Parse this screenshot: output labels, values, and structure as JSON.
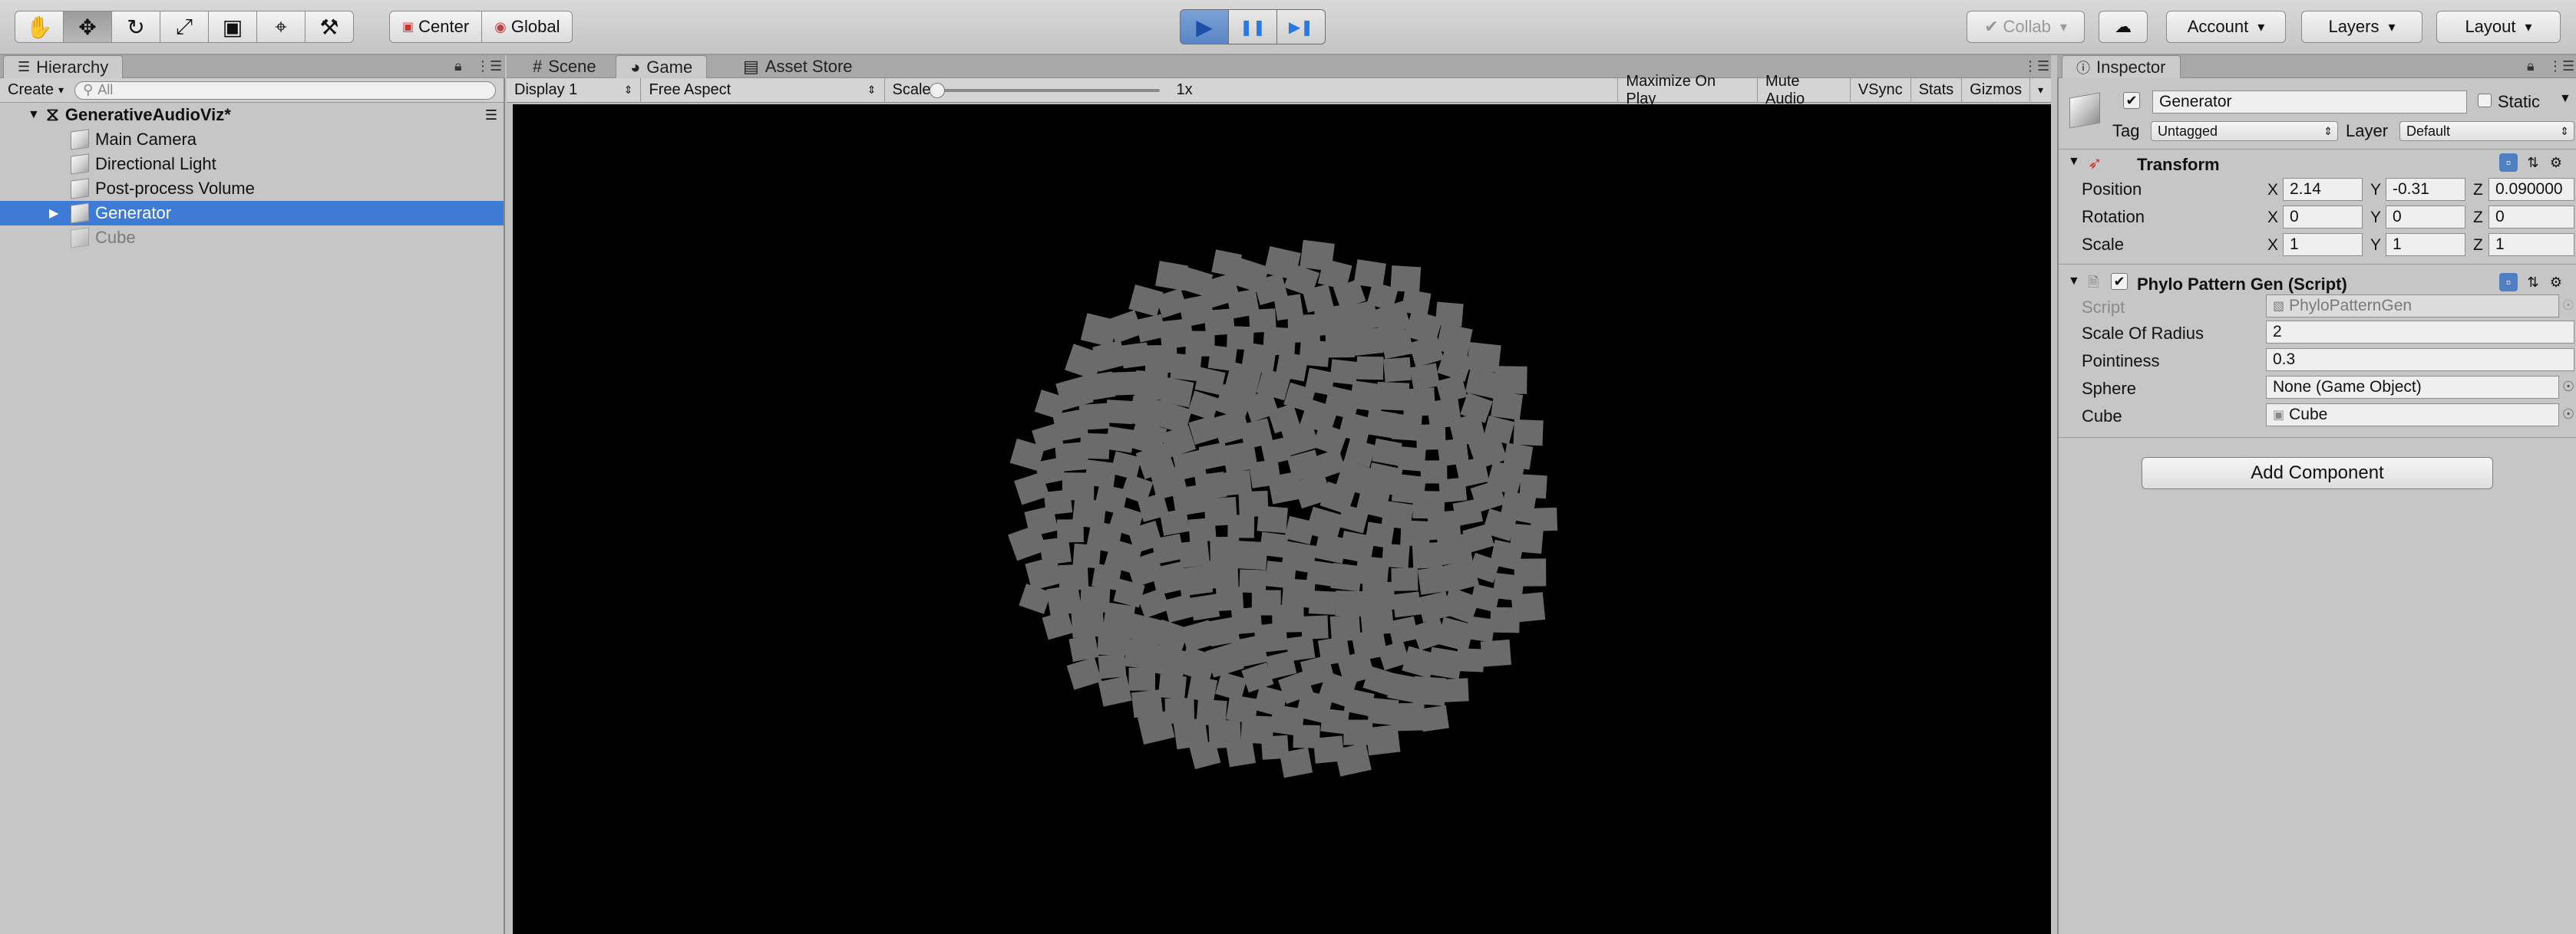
{
  "toolbar": {
    "tools": [
      {
        "name": "hand-tool",
        "icon": "hand-icon",
        "glyph": "✋"
      },
      {
        "name": "move-tool",
        "icon": "move-icon",
        "glyph": "✥"
      },
      {
        "name": "rotate-tool",
        "icon": "rotate-icon",
        "glyph": "↻"
      },
      {
        "name": "scale-tool",
        "icon": "scale-icon",
        "glyph": "⤢"
      },
      {
        "name": "rect-tool",
        "icon": "rect-transform-icon",
        "glyph": "▣"
      },
      {
        "name": "transform-tool",
        "icon": "transform-icon",
        "glyph": "⌖"
      },
      {
        "name": "custom-tool",
        "icon": "wrench-icon",
        "glyph": "⚒"
      }
    ],
    "pivot_label": "Center",
    "space_label": "Global",
    "play_glyph": "▶",
    "pause_glyph": "❚❚",
    "step_glyph": "▶❚",
    "collab_label": "Collab",
    "cloud_glyph": "☁",
    "account_label": "Account",
    "layers_label": "Layers",
    "layout_label": "Layout"
  },
  "hierarchy": {
    "tab_label": "Hierarchy",
    "create_label": "Create",
    "search_placeholder": "All",
    "scene_name": "GenerativeAudioViz*",
    "items": [
      {
        "label": "Main Camera",
        "selected": false,
        "dim": false,
        "expandable": false
      },
      {
        "label": "Directional Light",
        "selected": false,
        "dim": false,
        "expandable": false
      },
      {
        "label": "Post-process Volume",
        "selected": false,
        "dim": false,
        "expandable": false
      },
      {
        "label": "Generator",
        "selected": true,
        "dim": false,
        "expandable": true
      },
      {
        "label": "Cube",
        "selected": false,
        "dim": true,
        "expandable": false
      }
    ]
  },
  "game": {
    "tabs": [
      {
        "label": "Scene",
        "icon": "grid-icon",
        "glyph": "#"
      },
      {
        "label": "Game",
        "icon": "pacman-icon",
        "glyph": "◕"
      },
      {
        "label": "Asset Store",
        "icon": "store-icon",
        "glyph": "▤"
      }
    ],
    "display_label": "Display 1",
    "aspect_label": "Free Aspect",
    "scale_label": "Scale",
    "scale_value": "1x",
    "scale_fraction": 0.0,
    "maximize_label": "Maximize On Play",
    "mute_label": "Mute Audio",
    "vsync_label": "VSync",
    "stats_label": "Stats",
    "gizmos_label": "Gizmos",
    "cube_color": "#6b6b6b",
    "background_color": "#000000"
  },
  "inspector": {
    "tab_label": "Inspector",
    "object_name": "Generator",
    "static_label": "Static",
    "tag_label": "Tag",
    "tag_value": "Untagged",
    "layer_label": "Layer",
    "layer_value": "Default",
    "transform": {
      "title": "Transform",
      "position_label": "Position",
      "rotation_label": "Rotation",
      "scale_label": "Scale",
      "x": "X",
      "y": "Y",
      "z": "Z",
      "position": [
        "2.14",
        "-0.31",
        "0.090000"
      ],
      "rotation": [
        "0",
        "0",
        "0"
      ],
      "scale": [
        "1",
        "1",
        "1"
      ]
    },
    "script_component": {
      "title": "Phylo Pattern Gen (Script)",
      "script_label": "Script",
      "script_value": "PhyloPatternGen",
      "radius_label": "Scale Of Radius",
      "radius_value": "2",
      "pointiness_label": "Pointiness",
      "pointiness_value": "0.3",
      "sphere_label": "Sphere",
      "sphere_value": "None (Game Object)",
      "cube_label": "Cube",
      "cube_value": "Cube"
    },
    "add_component_label": "Add Component"
  }
}
